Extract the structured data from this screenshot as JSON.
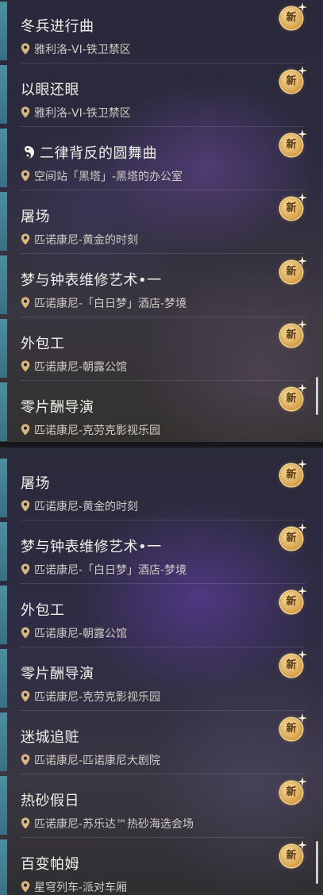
{
  "badge_label": "新",
  "colors": {
    "accent_bar": "#4e8ea0",
    "badge": "#d8a04a"
  },
  "panel1": {
    "items": [
      {
        "title": "冬兵进行曲",
        "location": "雅利洛-VI-铁卫禁区"
      },
      {
        "title": "以眼还眼",
        "location": "雅利洛-VI-铁卫禁区"
      },
      {
        "title": "二律背反的圆舞曲",
        "location": "空间站「黑塔」-黑塔的办公室",
        "icon": "special-quest-icon"
      },
      {
        "title": "屠场",
        "location": "匹诺康尼-黄金的时刻"
      },
      {
        "title": "梦与钟表维修艺术•一",
        "location": "匹诺康尼-「白日梦」酒店-梦境"
      },
      {
        "title": "外包工",
        "location": "匹诺康尼-朝露公馆"
      },
      {
        "title": "零片酬导演",
        "location": "匹诺康尼-克劳克影视乐园"
      }
    ]
  },
  "panel2": {
    "items": [
      {
        "title": "屠场",
        "location": "匹诺康尼-黄金的时刻"
      },
      {
        "title": "梦与钟表维修艺术•一",
        "location": "匹诺康尼-「白日梦」酒店-梦境"
      },
      {
        "title": "外包工",
        "location": "匹诺康尼-朝露公馆"
      },
      {
        "title": "零片酬导演",
        "location": "匹诺康尼-克劳克影视乐园"
      },
      {
        "title": "迷城追赃",
        "location": "匹诺康尼-匹诺康尼大剧院"
      },
      {
        "title": "热砂假日",
        "location": "匹诺康尼-苏乐达™热砂海选会场"
      },
      {
        "title": "百变帕姆",
        "location": "星穹列车-派对车厢"
      }
    ]
  }
}
